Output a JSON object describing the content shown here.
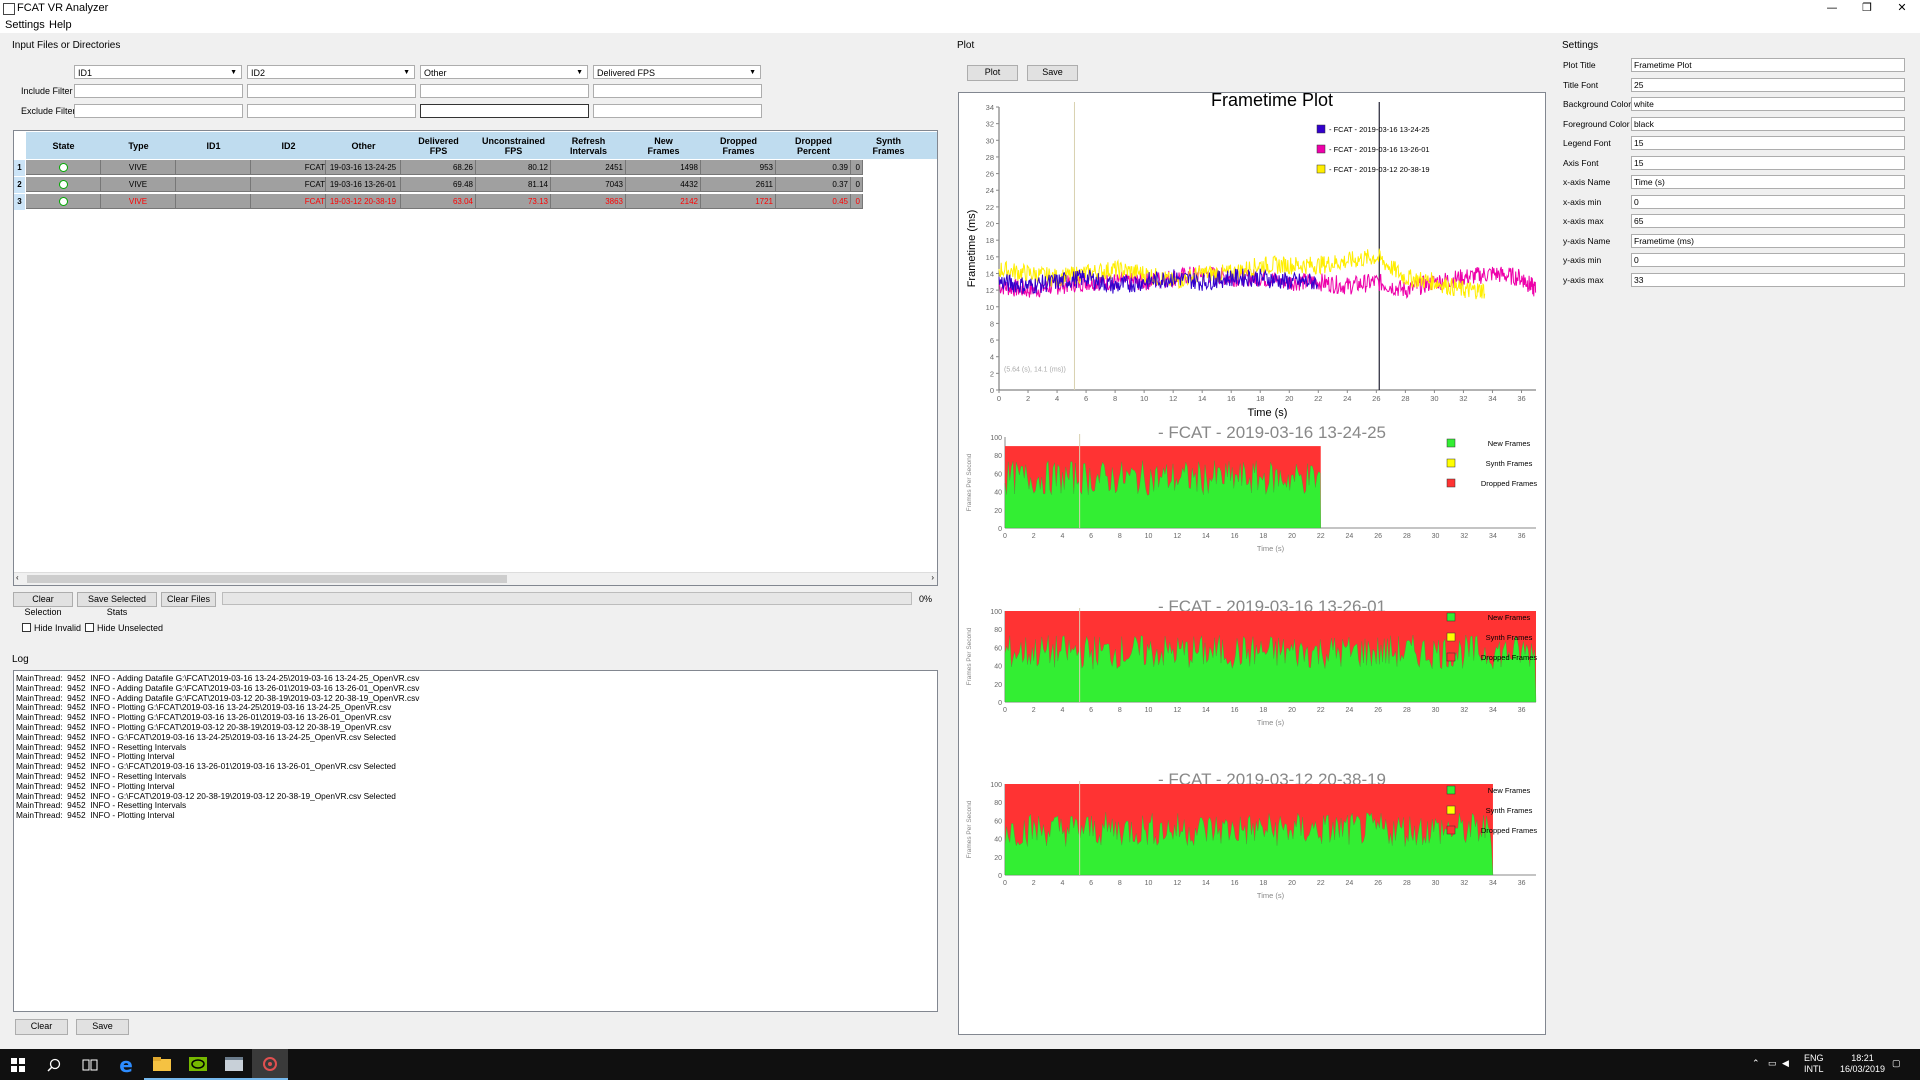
{
  "window": {
    "title": "FCAT VR Analyzer",
    "minimize": "—",
    "maximize": "❐",
    "close": "✕"
  },
  "menu": [
    "Settings",
    "Help"
  ],
  "input": {
    "group_title": "Input Files or Directories",
    "combos": [
      "ID1",
      "ID2",
      "Other",
      "Delivered FPS"
    ],
    "include_label": "Include Filter",
    "exclude_label": "Exclude Filter",
    "include_values": [
      "",
      "",
      "",
      ""
    ],
    "exclude_values": [
      "",
      "",
      "",
      ""
    ]
  },
  "table": {
    "headers": [
      "State",
      "Type",
      "ID1",
      "ID2",
      "Other",
      "Delivered\nFPS",
      "Unconstrained\nFPS",
      "Refresh\nIntervals",
      "New\nFrames",
      "Dropped\nFrames",
      "Dropped\nPercent",
      "Synth\nFrames"
    ],
    "rows": [
      {
        "num": "1",
        "type": "VIVE",
        "id1": "",
        "id2": "FCAT",
        "other": "19-03-16 13-24-25",
        "delivered": "68.26",
        "unconstrained": "80.12",
        "refresh": "2451",
        "new": "1498",
        "dropped": "953",
        "dropped_pct": "0.39",
        "synth": "0",
        "color": "#000000"
      },
      {
        "num": "2",
        "type": "VIVE",
        "id1": "",
        "id2": "FCAT",
        "other": "19-03-16 13-26-01",
        "delivered": "69.48",
        "unconstrained": "81.14",
        "refresh": "7043",
        "new": "4432",
        "dropped": "2611",
        "dropped_pct": "0.37",
        "synth": "0",
        "color": "#000000"
      },
      {
        "num": "3",
        "type": "VIVE",
        "id1": "",
        "id2": "FCAT",
        "other": "19-03-12 20-38-19",
        "delivered": "63.04",
        "unconstrained": "73.13",
        "refresh": "3863",
        "new": "2142",
        "dropped": "1721",
        "dropped_pct": "0.45",
        "synth": "0",
        "color": "#ff0000"
      }
    ]
  },
  "buttons": {
    "clear_selection": "Clear Selection",
    "save_selected": "Save Selected Stats",
    "clear_files": "Clear Files",
    "progress": "0%",
    "hide_invalid": "Hide Invalid",
    "hide_unselected": "Hide Unselected"
  },
  "log": {
    "title": "Log",
    "lines": [
      "MainThread:  9452  INFO - Adding Datafile G:\\FCAT\\2019-03-16 13-24-25\\2019-03-16 13-24-25_OpenVR.csv",
      "MainThread:  9452  INFO - Adding Datafile G:\\FCAT\\2019-03-16 13-26-01\\2019-03-16 13-26-01_OpenVR.csv",
      "MainThread:  9452  INFO - Adding Datafile G:\\FCAT\\2019-03-12 20-38-19\\2019-03-12 20-38-19_OpenVR.csv",
      "MainThread:  9452  INFO - Plotting G:\\FCAT\\2019-03-16 13-24-25\\2019-03-16 13-24-25_OpenVR.csv",
      "MainThread:  9452  INFO - Plotting G:\\FCAT\\2019-03-16 13-26-01\\2019-03-16 13-26-01_OpenVR.csv",
      "MainThread:  9452  INFO - Plotting G:\\FCAT\\2019-03-12 20-38-19\\2019-03-12 20-38-19_OpenVR.csv",
      "MainThread:  9452  INFO - G:\\FCAT\\2019-03-16 13-24-25\\2019-03-16 13-24-25_OpenVR.csv Selected",
      "MainThread:  9452  INFO - Resetting Intervals",
      "MainThread:  9452  INFO - Plotting Interval",
      "MainThread:  9452  INFO - G:\\FCAT\\2019-03-16 13-26-01\\2019-03-16 13-26-01_OpenVR.csv Selected",
      "MainThread:  9452  INFO - Resetting Intervals",
      "MainThread:  9452  INFO - Plotting Interval",
      "MainThread:  9452  INFO - G:\\FCAT\\2019-03-12 20-38-19\\2019-03-12 20-38-19_OpenVR.csv Selected",
      "MainThread:  9452  INFO - Resetting Intervals",
      "MainThread:  9452  INFO - Plotting Interval"
    ],
    "clear": "Clear",
    "save": "Save"
  },
  "plot": {
    "group_title": "Plot",
    "plot_button": "Plot",
    "save_button": "Save"
  },
  "chart_data": [
    {
      "type": "line",
      "title": "Frametime Plot",
      "xlabel": "Time (s)",
      "ylabel": "Frametime (ms)",
      "xlim": [
        0,
        37
      ],
      "ylim": [
        0,
        34
      ],
      "xticks": [
        0,
        2,
        4,
        6,
        8,
        10,
        12,
        14,
        16,
        18,
        20,
        22,
        24,
        26,
        28,
        30,
        32,
        34,
        36
      ],
      "yticks": [
        0,
        2,
        4,
        6,
        8,
        10,
        12,
        14,
        16,
        18,
        20,
        22,
        24,
        26,
        28,
        30,
        32,
        34
      ],
      "legend_position": "top-right",
      "cursor_readout": "(5.64 (s), 14.1 (ms))",
      "vertical_markers": [
        5.2,
        26.2
      ],
      "series": [
        {
          "name": "- FCAT - 2019-03-16 13-24-25",
          "color": "#3300cc",
          "x": [
            0,
            2,
            4,
            6,
            8,
            10,
            12,
            14,
            16,
            18,
            20,
            22
          ],
          "y": [
            13,
            12.5,
            13,
            13.5,
            12.5,
            13,
            13.5,
            13,
            13.5,
            13.5,
            13,
            13
          ]
        },
        {
          "name": "- FCAT - 2019-03-16 13-26-01",
          "color": "#ee00aa",
          "x": [
            0,
            2,
            4,
            6,
            8,
            10,
            12,
            14,
            16,
            18,
            20,
            22,
            24,
            26,
            28,
            30,
            32,
            34,
            36,
            37
          ],
          "y": [
            12.5,
            12,
            12.5,
            13,
            13,
            13,
            13.5,
            14,
            13.5,
            13.5,
            13,
            13,
            12.5,
            13,
            12,
            13,
            13.5,
            14,
            13.5,
            12
          ]
        },
        {
          "name": "- FCAT - 2019-03-12 20-38-19",
          "color": "#ffee00",
          "x": [
            0,
            2,
            4,
            6,
            8,
            10,
            12,
            14,
            16,
            18,
            20,
            22,
            24,
            26,
            28,
            30,
            32,
            33.5
          ],
          "y": [
            14.5,
            14,
            13.5,
            14,
            14.5,
            14,
            13,
            14,
            14,
            15,
            15,
            15,
            15.5,
            16,
            13.5,
            13,
            12,
            12
          ]
        }
      ]
    },
    {
      "type": "area",
      "title": "- FCAT - 2019-03-16 13-24-25",
      "xlabel": "Time (s)",
      "ylabel": "Frames Per Second",
      "xlim": [
        0,
        37
      ],
      "ylim": [
        0,
        100
      ],
      "end_x": 22,
      "series_names": [
        "New Frames",
        "Synth Frames",
        "Dropped Frames"
      ],
      "series_colors": [
        "#33ee33",
        "#ffff00",
        "#ff3333"
      ],
      "total_fps": 90,
      "new_frames_avg": 55
    },
    {
      "type": "area",
      "title": "- FCAT - 2019-03-16 13-26-01",
      "xlabel": "Time (s)",
      "ylabel": "Frames Per Second",
      "xlim": [
        0,
        37
      ],
      "ylim": [
        0,
        100
      ],
      "end_x": 37,
      "series_names": [
        "New Frames",
        "Synth Frames",
        "Dropped Frames"
      ],
      "series_colors": [
        "#33ee33",
        "#ffff00",
        "#ff3333"
      ],
      "total_fps": 100,
      "new_frames_avg": 55
    },
    {
      "type": "area",
      "title": "- FCAT - 2019-03-12 20-38-19",
      "xlabel": "Time (s)",
      "ylabel": "Frames Per Second",
      "xlim": [
        0,
        37
      ],
      "ylim": [
        0,
        100
      ],
      "end_x": 34,
      "series_names": [
        "New Frames",
        "Synth Frames",
        "Dropped Frames"
      ],
      "series_colors": [
        "#33ee33",
        "#ffff00",
        "#ff3333"
      ],
      "total_fps": 100,
      "new_frames_avg": 50
    }
  ],
  "settings": {
    "group_title": "Settings",
    "fields": [
      {
        "label": "Plot Title",
        "value": "Frametime Plot"
      },
      {
        "label": "Title Font",
        "value": "25"
      },
      {
        "label": "Background Color",
        "value": "white"
      },
      {
        "label": "Foreground Color",
        "value": "black"
      },
      {
        "label": "Legend Font",
        "value": "15"
      },
      {
        "label": "Axis Font",
        "value": "15"
      },
      {
        "label": "x-axis Name",
        "value": "Time (s)"
      },
      {
        "label": "x-axis min",
        "value": "0"
      },
      {
        "label": "x-axis max",
        "value": "65"
      },
      {
        "label": "y-axis Name",
        "value": "Frametime (ms)"
      },
      {
        "label": "y-axis min",
        "value": "0"
      },
      {
        "label": "y-axis max",
        "value": "33"
      }
    ]
  },
  "taskbar": {
    "lang": "ENG",
    "region": "INTL",
    "time": "18:21",
    "date": "16/03/2019"
  }
}
